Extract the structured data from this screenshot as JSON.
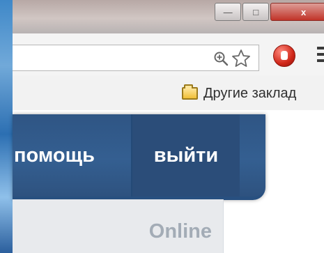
{
  "browser": {
    "window_controls": {
      "minimize_symbol": "—",
      "maximize_symbol": "□",
      "close_symbol": "x"
    },
    "toolbar_icons": {
      "zoom": "zoom-icon",
      "star": "star-icon",
      "extension": "extension-icon",
      "menu": "menu-icon"
    },
    "bookmarks": {
      "other_bookmarks": "Другие заклад"
    }
  },
  "site": {
    "nav": {
      "help": "помощь",
      "logout": "выйти"
    },
    "status": {
      "online": "Online"
    }
  },
  "colors": {
    "site_nav": "#2f5584",
    "site_nav_active": "#2b4d79",
    "online_text": "#a3acb6",
    "extension_red": "#d02719"
  }
}
